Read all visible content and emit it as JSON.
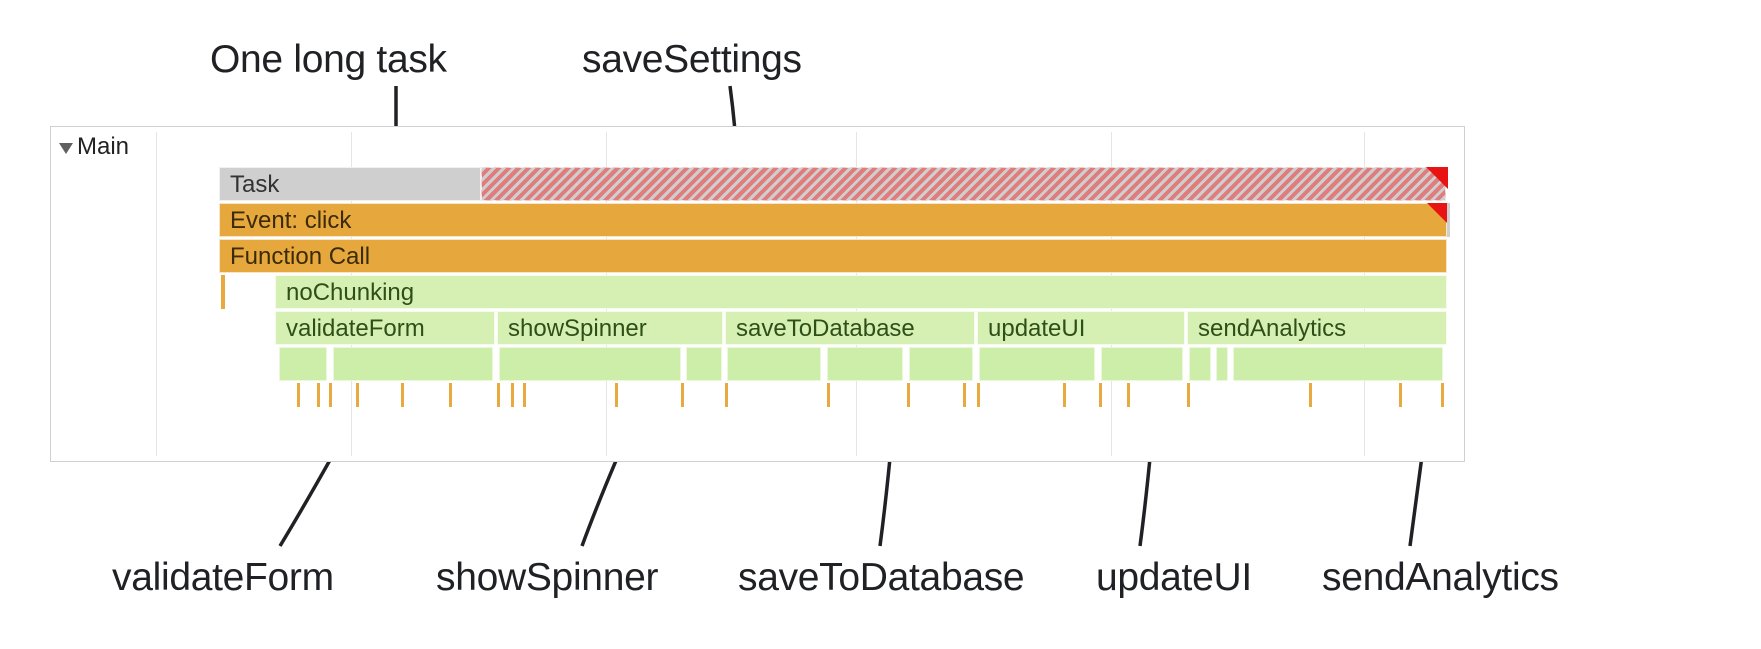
{
  "annotations": {
    "top_left": "One long task",
    "top_right": "saveSettings",
    "bottom_1": "validateForm",
    "bottom_2": "showSpinner",
    "bottom_3": "saveToDatabase",
    "bottom_4": "updateUI",
    "bottom_5": "sendAnalytics"
  },
  "panel": {
    "track_label": "Main",
    "rows": {
      "task": "Task",
      "event": "Event: click",
      "funcall": "Function Call",
      "nochunking": "noChunking",
      "validateForm": "validateForm",
      "showSpinner": "showSpinner",
      "saveToDatabase": "saveToDatabase",
      "updateUI": "updateUI",
      "sendAnalytics": "sendAnalytics"
    }
  }
}
